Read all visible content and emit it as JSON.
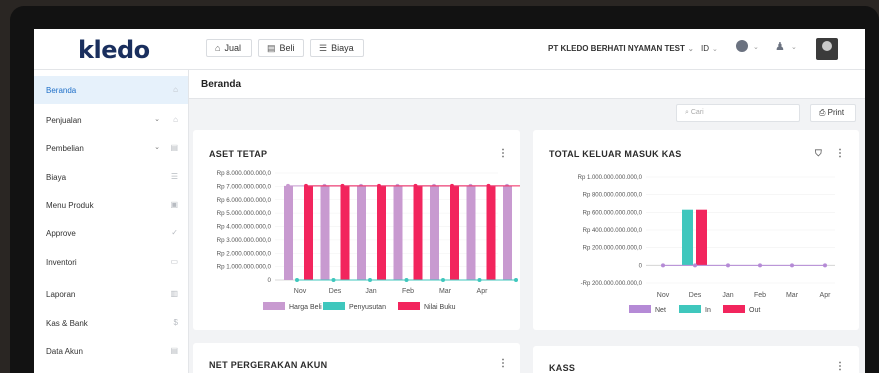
{
  "app": {
    "logo": "kledo",
    "company": "PT KLEDO BERHATI NYAMAN TEST",
    "lang": "ID"
  },
  "toolbar": {
    "jual": "Jual",
    "beli": "Beli",
    "biaya": "Biaya"
  },
  "sidebar": {
    "items": [
      {
        "label": "Beranda",
        "icon": "home-icon",
        "active": true
      },
      {
        "label": "Penjualan",
        "icon": "shop-icon",
        "chev": true
      },
      {
        "label": "Pembelian",
        "icon": "bag-icon",
        "chev": true
      },
      {
        "label": "Biaya",
        "icon": "wallet-icon"
      },
      {
        "label": "Menu Produk",
        "icon": "box-icon"
      },
      {
        "label": "Approve",
        "icon": "check-icon"
      },
      {
        "label": "Inventori",
        "icon": "warehouse-icon"
      },
      {
        "label": "Laporan",
        "icon": "chart-icon"
      },
      {
        "label": "Kas & Bank",
        "icon": "dollar-icon"
      },
      {
        "label": "Data Akun",
        "icon": "book-icon"
      }
    ]
  },
  "page": {
    "title": "Beranda",
    "search_placeholder": "Cari",
    "print_label": "Print"
  },
  "cards": {
    "aset": "ASET TETAP",
    "kas": "TOTAL KELUAR MASUK KAS",
    "net": "NET PERGERAKAN AKUN",
    "kass": "KASS"
  },
  "colors": {
    "accent": "#1e6fc8",
    "harga_beli": "#c89ad0",
    "penyusutan": "#3fc7bd",
    "nilai_buku": "#f2255d",
    "net": "#b58ad6"
  },
  "chart_data": [
    {
      "type": "bar",
      "categories": [
        "Nov",
        "Des",
        "Jan",
        "Feb",
        "Mar",
        "Apr"
      ],
      "ytick_labels": [
        "Rp 8.000.000.000,0",
        "Rp 7.000.000.000,0",
        "Rp 6.000.000.000,0",
        "Rp 5.000.000.000,0",
        "Rp 4.000.000.000,0",
        "Rp 3.000.000.000,0",
        "Rp 2.000.000.000,0",
        "Rp 1.000.000.000,0",
        "0"
      ],
      "ylim": [
        0,
        8300000000
      ],
      "series": [
        {
          "name": "Harga Beli",
          "color": "#c89ad0",
          "values": [
            7300000000,
            7300000000,
            7300000000,
            7300000000,
            7300000000,
            7300000000,
            7300000000
          ]
        },
        {
          "name": "Penyusutan",
          "color": "#3fc7bd",
          "values": [
            0,
            0,
            0,
            0,
            0,
            0,
            0
          ]
        },
        {
          "name": "Nilai Buku",
          "color": "#f2255d",
          "values": [
            7300000000,
            7300000000,
            7300000000,
            7300000000,
            7300000000,
            7300000000,
            7300000000
          ]
        }
      ]
    },
    {
      "type": "bar",
      "categories": [
        "Nov",
        "Des",
        "Jan",
        "Feb",
        "Mar",
        "Apr"
      ],
      "ytick_labels": [
        "Rp 1.000.000.000.000,0",
        "Rp 800.000.000.000,0",
        "Rp 600.000.000.000,0",
        "Rp 400.000.000.000,0",
        "Rp 200.000.000.000,0",
        "0",
        "-Rp 200.000.000.000,0"
      ],
      "ylim": [
        -200000000000,
        1000000000000
      ],
      "series": [
        {
          "name": "Net",
          "color": "#b58ad6",
          "values": [
            0,
            0,
            0,
            0,
            0,
            0
          ]
        },
        {
          "name": "In",
          "color": "#3fc7bd",
          "values": [
            0,
            630000000000,
            0,
            0,
            0,
            0
          ]
        },
        {
          "name": "Out",
          "color": "#f2255d",
          "values": [
            0,
            630000000000,
            0,
            0,
            0,
            0
          ]
        }
      ]
    }
  ]
}
